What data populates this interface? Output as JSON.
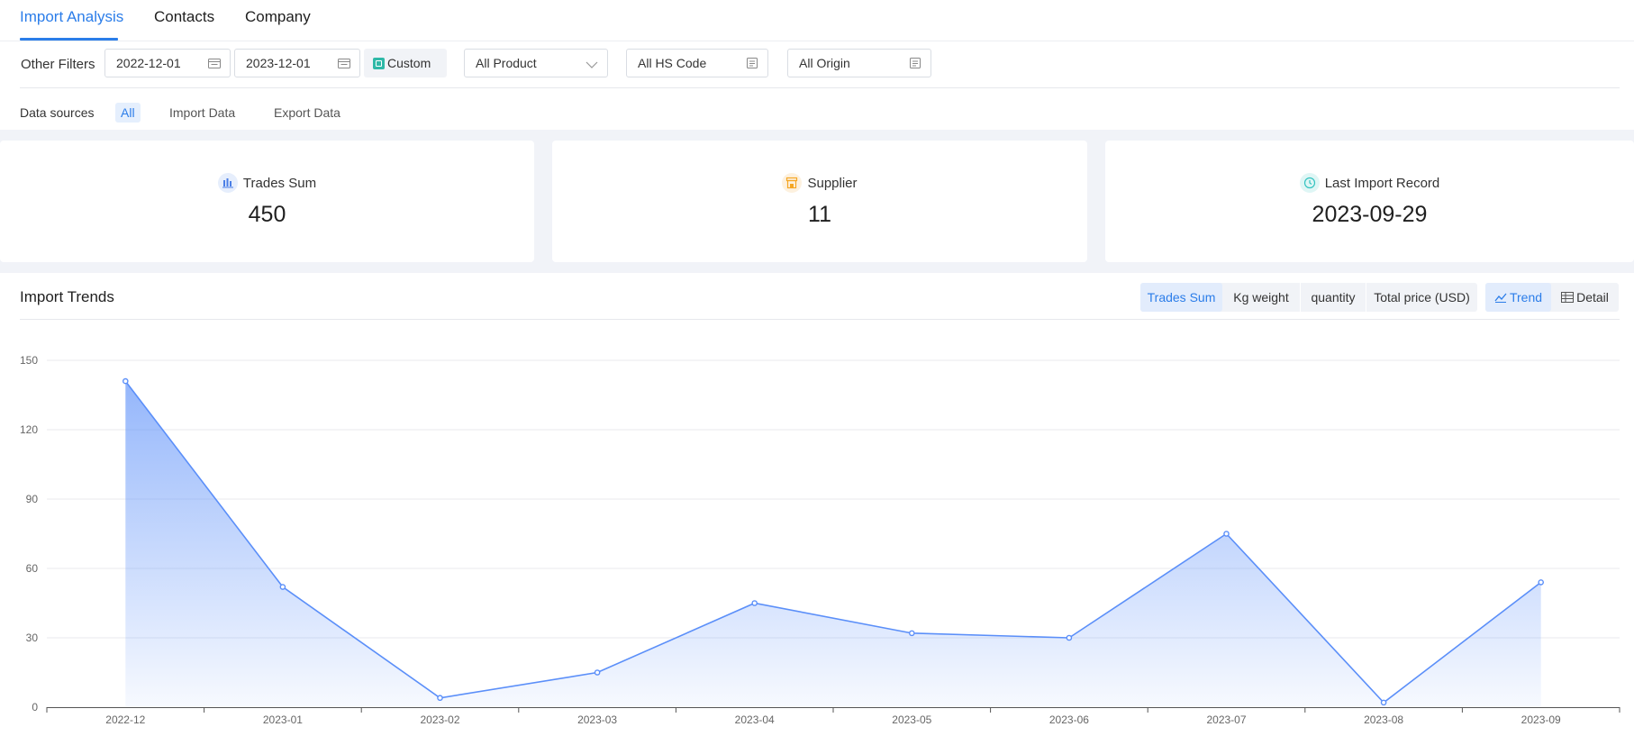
{
  "tabs": [
    {
      "label": "Import Analysis",
      "active": true
    },
    {
      "label": "Contacts",
      "active": false
    },
    {
      "label": "Company",
      "active": false
    }
  ],
  "filters": {
    "label": "Other Filters",
    "date_from": "2022-12-01",
    "date_to": "2023-12-01",
    "custom_label": "Custom",
    "product": "All Product",
    "hs_code": "All HS Code",
    "origin": "All Origin"
  },
  "data_sources": {
    "label": "Data sources",
    "options": [
      "All",
      "Import Data",
      "Export Data"
    ],
    "selected": "All"
  },
  "stats": [
    {
      "label": "Trades Sum",
      "value": "450",
      "icon": "bar-chart-icon",
      "color": "#4a7ee6"
    },
    {
      "label": "Supplier",
      "value": "11",
      "icon": "store-icon",
      "color": "#f5a623"
    },
    {
      "label": "Last Import Record",
      "value": "2023-09-29",
      "icon": "clock-icon",
      "color": "#33c3c0"
    }
  ],
  "trends": {
    "title": "Import Trends",
    "metrics": [
      "Trades Sum",
      "Kg weight",
      "quantity",
      "Total price (USD)"
    ],
    "selected_metric": "Trades Sum",
    "views": [
      "Trend",
      "Detail"
    ],
    "selected_view": "Trend"
  },
  "colors": {
    "accent": "#2b7de9",
    "line": "#5b8ff9"
  },
  "chart_data": {
    "type": "area",
    "categories": [
      "2022-12",
      "2023-01",
      "2023-02",
      "2023-03",
      "2023-04",
      "2023-05",
      "2023-06",
      "2023-07",
      "2023-08",
      "2023-09"
    ],
    "series": [
      {
        "values": [
          141,
          52,
          4,
          15,
          45,
          32,
          30,
          75,
          2,
          54
        ]
      }
    ],
    "ylim": [
      0,
      150
    ],
    "yticks": [
      0,
      30,
      60,
      90,
      120,
      150
    ],
    "grid": true,
    "title": "",
    "xlabel": "",
    "ylabel": ""
  }
}
